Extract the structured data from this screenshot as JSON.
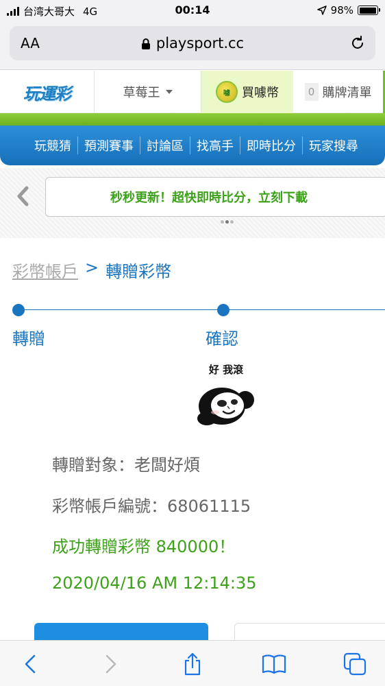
{
  "status_bar": {
    "carrier": "台湾大哥大",
    "network": "4G",
    "time": "00:14",
    "battery": "98%",
    "battery_level": 0.98
  },
  "browser": {
    "text_size_label": "AA",
    "url": "playsport.cc"
  },
  "site_header": {
    "logo_text": "玩運彩",
    "dropdown_label": "草莓王",
    "buy_coin_label": "買噱幣",
    "buy_coin_icon_text": "噱",
    "cart_count": "0",
    "cart_label": "購牌清單"
  },
  "nav": {
    "items": [
      "玩競猜",
      "預測賽事",
      "討論區",
      "找高手",
      "即時比分",
      "玩家搜尋"
    ]
  },
  "banner": {
    "text": "秒秒更新！超快即時比分，立刻下載",
    "active_dot": 1
  },
  "breadcrumb": {
    "parent": "彩幣帳戶",
    "separator": ">",
    "current": "轉贈彩幣"
  },
  "steps": [
    {
      "label": "轉贈"
    },
    {
      "label": "確認"
    }
  ],
  "sticker": {
    "caption": "好 我滾"
  },
  "result": {
    "recipient_line": "轉贈對象：老闆好煩",
    "account_line": "彩幣帳戶編號：68061115",
    "success_line": "成功轉贈彩幣 840000！",
    "timestamp": "2020/04/16 AM 12:14:35"
  },
  "colors": {
    "accent_blue": "#1a75c0",
    "success_green": "#3da21a",
    "nav_green": "#7cc12e",
    "buy_coin_bg": "#ebf9c8"
  }
}
